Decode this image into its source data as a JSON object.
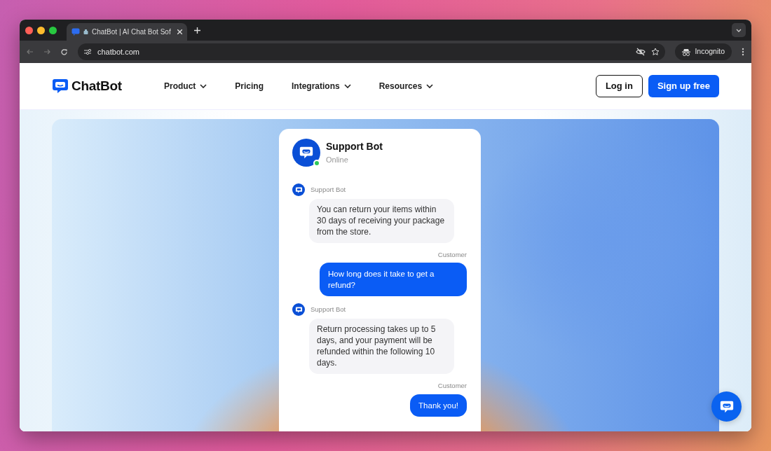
{
  "browser": {
    "tab": {
      "title": "ChatBot | AI Chat Bot Sof",
      "selected": true
    },
    "url": "chatbot.com",
    "profile": "Incognito"
  },
  "nav": {
    "logo": "ChatBot",
    "items": [
      {
        "label": "Product",
        "dropdown": true
      },
      {
        "label": "Pricing",
        "dropdown": false
      },
      {
        "label": "Integrations",
        "dropdown": true
      },
      {
        "label": "Resources",
        "dropdown": true
      }
    ],
    "login": "Log in",
    "signup": "Sign up free"
  },
  "chat": {
    "name": "Support Bot",
    "status": "Online",
    "online": true,
    "messages": [
      {
        "kind": "bot",
        "author": "Support Bot",
        "text": "You can return your items within 30 days of receiving your package from the store."
      },
      {
        "kind": "customer",
        "author": "Customer",
        "text": "How long does it take to get a refund?"
      },
      {
        "kind": "bot",
        "author": "Support Bot",
        "text": "Return processing takes up to 5 days, and your payment will be refunded within the following 10 days."
      },
      {
        "kind": "customer",
        "author": "Customer",
        "text": "Thank you!"
      }
    ]
  }
}
